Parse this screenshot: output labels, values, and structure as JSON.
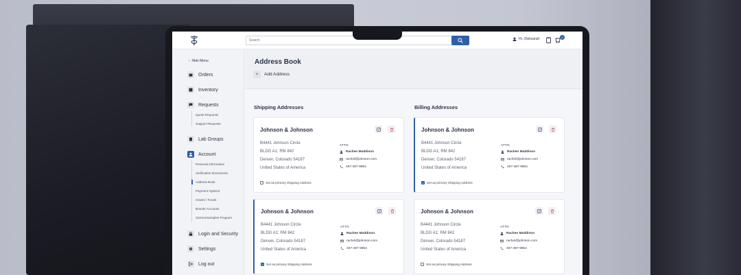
{
  "header": {
    "search_placeholder": "Search",
    "greeting": "Hi, Oleksandr",
    "cart_count": "0"
  },
  "sidebar": {
    "hide_menu": "Hide Menu",
    "items": [
      {
        "label": "Orders",
        "icon": "bag-icon"
      },
      {
        "label": "Inventory",
        "icon": "box-icon"
      },
      {
        "label": "Requests",
        "icon": "chat-icon"
      },
      {
        "label": "Lab Groups",
        "icon": "flask-icon"
      },
      {
        "label": "Account",
        "icon": "user-icon"
      },
      {
        "label": "Login and Security",
        "icon": "lock-icon"
      },
      {
        "label": "Settings",
        "icon": "gear-icon"
      },
      {
        "label": "Log out",
        "icon": "logout-icon"
      }
    ],
    "requests_sub": [
      "Quote Requests",
      "Support Requests"
    ],
    "account_sub": [
      "Personal information",
      "Verification Documents",
      "Address Book",
      "Payment Options",
      "Grants / Funds",
      "Brands Accounts",
      "ScienceSamples Program"
    ],
    "active_sub": "Address Book"
  },
  "main": {
    "title": "Address Book",
    "add_label": "Add Address",
    "shipping_title": "Shipping Addresses",
    "billing_title": "Billing Addresses"
  },
  "cards": [
    {
      "company": "Johnson & Johnson",
      "line1": "B4441 Johnson Circle",
      "line2": "BLDG A1; RM 842",
      "line3": "Denver, Colorado 54187",
      "line4": "United States of America",
      "attn": "ATTN",
      "contact_name": "Rachen Maddison",
      "email": "rachel@johnson.com",
      "phone": "457-487-9854",
      "checkbox_label": "Set as primary Shipping Address",
      "primary": false
    },
    {
      "company": "Johnson & Johnson",
      "line1": "B4441 Johnson Circle",
      "line2": "BLDG A1; RM 842",
      "line3": "Denver, Colorado 54187",
      "line4": "United States of America",
      "attn": "ATTN",
      "contact_name": "Rachen Maddison",
      "email": "rachel@johnson.com",
      "phone": "457-487-9854",
      "checkbox_label": "Set as primary Shipping Address",
      "primary": true
    },
    {
      "company": "Johnson & Johnson",
      "line1": "B4441 Johnson Circle",
      "line2": "BLDG A1; RM 842",
      "line3": "Denver, Colorado 54187",
      "line4": "United States of America",
      "attn": "ATTN",
      "contact_name": "Rachen Maddison",
      "email": "rachel@johnson.com",
      "phone": "457-487-9854",
      "checkbox_label": "Set as primary Shipping Address",
      "primary": true
    },
    {
      "company": "Johnson & Johnson",
      "line1": "B4441 Johnson Circle",
      "line2": "BLDG A1; RM 842",
      "line3": "Denver, Colorado 54187",
      "line4": "United States of America",
      "attn": "ATTN",
      "contact_name": "Rachen Maddison",
      "email": "rachel@johnson.com",
      "phone": "457-487-9854",
      "checkbox_label": "Set as primary Shipping Address",
      "primary": false
    }
  ],
  "colors": {
    "accent": "#2f5fa8",
    "text": "#2c3345",
    "delete": "#d9534f"
  }
}
